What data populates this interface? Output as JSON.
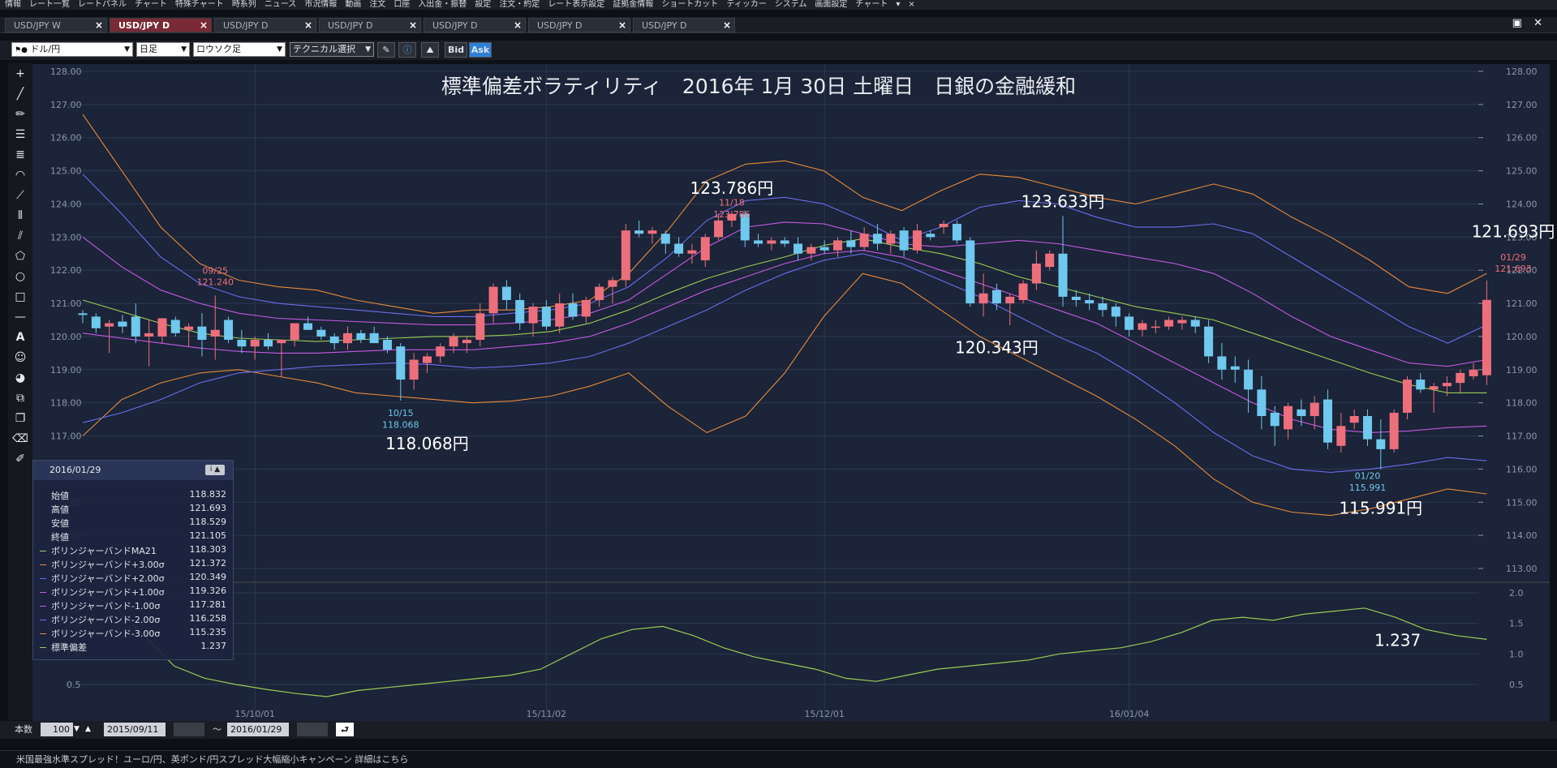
{
  "menu": {
    "items": [
      "情報",
      "レート一覧",
      "レートパネル",
      "チャート",
      "特殊チャート",
      "時系列",
      "ニュース",
      "市況情報",
      "動画",
      "注文",
      "口座",
      "入出金・振替",
      "設定",
      "注文・約定",
      "レート表示設定",
      "証拠金情報",
      "ショートカット",
      "ティッカー",
      "システム",
      "画面設定",
      "チャート"
    ],
    "extra": [
      "▾",
      "×"
    ]
  },
  "tabs": [
    {
      "label": "USD/JPY W",
      "active": false
    },
    {
      "label": "USD/JPY D",
      "active": true
    },
    {
      "label": "USD/JPY D",
      "active": false
    },
    {
      "label": "USD/JPY D",
      "active": false
    },
    {
      "label": "USD/JPY D",
      "active": false
    },
    {
      "label": "USD/JPY D",
      "active": false
    },
    {
      "label": "USD/JPY D",
      "active": false
    }
  ],
  "toolbar": {
    "pair": "ドル/円",
    "period": "日足",
    "chart_style": "ロウソク足",
    "technical": "テクニカル選択",
    "bid": "Bid",
    "ask": "Ask",
    "close_icon": "×"
  },
  "info_panel": {
    "date": "2016/01/29",
    "icon_label": "i ▲",
    "rows": [
      {
        "label": "始値",
        "value": "118.832",
        "color": ""
      },
      {
        "label": "高値",
        "value": "121.693",
        "color": ""
      },
      {
        "label": "安値",
        "value": "118.529",
        "color": ""
      },
      {
        "label": "終値",
        "value": "121.105",
        "color": ""
      },
      {
        "label": "ボリンジャーバンドMA21",
        "value": "118.303",
        "color": "#9acd55"
      },
      {
        "label": "ボリンジャーバンド+3.00σ",
        "value": "121.372",
        "color": "#e88a3a"
      },
      {
        "label": "ボリンジャーバンド+2.00σ",
        "value": "120.349",
        "color": "#6c6cf0"
      },
      {
        "label": "ボリンジャーバンド+1.00σ",
        "value": "119.326",
        "color": "#c659e6"
      },
      {
        "label": "ボリンジャーバンド-1.00σ",
        "value": "117.281",
        "color": "#c659e6"
      },
      {
        "label": "ボリンジャーバンド-2.00σ",
        "value": "116.258",
        "color": "#6c6cf0"
      },
      {
        "label": "ボリンジャーバンド-3.00σ",
        "value": "115.235",
        "color": "#e88a3a"
      },
      {
        "label": "標準偏差",
        "value": "1.237",
        "color": "#9acd55"
      }
    ]
  },
  "bottom": {
    "count_label": "本数",
    "count_value": "100",
    "from_date": "2015/09/11",
    "tilde": "～",
    "to_date": "2016/01/29",
    "reset_icon": "⮐"
  },
  "status_text": "米国最強水準スプレッド！ユーロ/円、英ポンド/円スプレッド大幅縮小キャンペーン 詳細はこちら",
  "colors": {
    "bg": "#1b2438",
    "up": "#ee6f7c",
    "down": "#6fc8ee",
    "ma": "#9acd55",
    "sd1": "#c659e6",
    "sd2": "#6c6cf0",
    "sd3": "#e88a3a"
  },
  "chart_data": {
    "type": "candlestick",
    "title": "標準偏差ボラティリティ　2016年 1月 30日 土曜日　日銀の金融緩和",
    "ylim": [
      113,
      128
    ],
    "yticks": [
      "128.00",
      "127.00",
      "126.00",
      "125.00",
      "124.00",
      "123.00",
      "122.00",
      "121.00",
      "120.00",
      "119.00",
      "118.00",
      "117.00",
      "116.00",
      "115.00",
      "114.00",
      "113.00"
    ],
    "x_labels": [
      {
        "label": "15/10/01",
        "index": 13
      },
      {
        "label": "15/11/02",
        "index": 35
      },
      {
        "label": "15/12/01",
        "index": 56
      },
      {
        "label": "16/01/04",
        "index": 79
      }
    ],
    "candles": [
      [
        120.7,
        120.8,
        120.4,
        120.65
      ],
      [
        120.6,
        120.7,
        120.1,
        120.25
      ],
      [
        120.3,
        120.5,
        119.5,
        120.4
      ],
      [
        120.45,
        120.65,
        120.1,
        120.3
      ],
      [
        120.6,
        121.0,
        119.8,
        120.0
      ],
      [
        120.0,
        120.5,
        119.1,
        120.1
      ],
      [
        120.0,
        120.4,
        119.8,
        120.55
      ],
      [
        120.5,
        120.6,
        120.0,
        120.1
      ],
      [
        120.2,
        120.4,
        119.7,
        120.3
      ],
      [
        120.3,
        120.7,
        119.4,
        119.9
      ],
      [
        120.0,
        121.24,
        119.3,
        120.2
      ],
      [
        120.5,
        120.6,
        119.8,
        119.9
      ],
      [
        119.9,
        120.2,
        119.5,
        119.7
      ],
      [
        119.7,
        120.0,
        119.3,
        119.9
      ],
      [
        119.9,
        120.1,
        119.6,
        119.7
      ],
      [
        119.8,
        119.9,
        118.8,
        119.9
      ],
      [
        119.9,
        120.4,
        119.7,
        120.4
      ],
      [
        120.4,
        120.6,
        120.2,
        120.2
      ],
      [
        120.2,
        120.3,
        119.9,
        120.0
      ],
      [
        120.0,
        120.1,
        119.6,
        119.8
      ],
      [
        119.8,
        120.3,
        119.6,
        120.1
      ],
      [
        120.1,
        120.2,
        119.8,
        119.9
      ],
      [
        120.1,
        120.3,
        119.8,
        119.8
      ],
      [
        119.9,
        120.0,
        119.5,
        119.6
      ],
      [
        119.7,
        119.8,
        118.068,
        118.7
      ],
      [
        118.7,
        119.5,
        118.4,
        119.3
      ],
      [
        119.2,
        119.5,
        118.9,
        119.4
      ],
      [
        119.4,
        119.8,
        119.2,
        119.7
      ],
      [
        119.7,
        120.1,
        119.5,
        120.0
      ],
      [
        119.8,
        120.0,
        119.5,
        119.9
      ],
      [
        119.9,
        121.0,
        119.7,
        120.7
      ],
      [
        120.7,
        121.6,
        120.4,
        121.5
      ],
      [
        121.5,
        121.7,
        120.8,
        121.1
      ],
      [
        121.1,
        121.3,
        120.2,
        120.4
      ],
      [
        120.4,
        121.0,
        120.0,
        120.9
      ],
      [
        120.9,
        121.1,
        120.2,
        120.3
      ],
      [
        120.3,
        121.3,
        120.1,
        121.0
      ],
      [
        121.0,
        121.3,
        120.5,
        120.6
      ],
      [
        120.6,
        121.2,
        120.4,
        121.1
      ],
      [
        121.1,
        121.6,
        120.9,
        121.5
      ],
      [
        121.5,
        121.8,
        121.0,
        121.7
      ],
      [
        121.7,
        123.4,
        121.5,
        123.2
      ],
      [
        123.2,
        123.5,
        123.0,
        123.1
      ],
      [
        123.1,
        123.3,
        122.8,
        123.2
      ],
      [
        123.1,
        123.2,
        122.5,
        122.8
      ],
      [
        122.8,
        123.0,
        122.4,
        122.5
      ],
      [
        122.5,
        122.8,
        122.2,
        122.6
      ],
      [
        122.3,
        123.1,
        122.1,
        123.0
      ],
      [
        123.0,
        123.7,
        122.9,
        123.5
      ],
      [
        123.5,
        123.786,
        123.3,
        123.7
      ],
      [
        123.7,
        123.8,
        122.7,
        122.9
      ],
      [
        122.9,
        123.1,
        122.7,
        122.8
      ],
      [
        122.8,
        123.0,
        122.6,
        122.9
      ],
      [
        122.9,
        123.0,
        122.7,
        122.8
      ],
      [
        122.8,
        123.0,
        122.3,
        122.5
      ],
      [
        122.5,
        122.8,
        122.3,
        122.7
      ],
      [
        122.7,
        122.9,
        122.5,
        122.6
      ],
      [
        122.6,
        123.0,
        122.4,
        122.9
      ],
      [
        122.9,
        123.2,
        122.5,
        122.7
      ],
      [
        122.7,
        123.3,
        122.6,
        123.1
      ],
      [
        123.1,
        123.4,
        122.6,
        122.8
      ],
      [
        122.8,
        123.2,
        122.5,
        123.1
      ],
      [
        123.2,
        123.3,
        122.4,
        122.6
      ],
      [
        122.6,
        123.4,
        122.5,
        123.2
      ],
      [
        123.1,
        123.2,
        122.9,
        123.0
      ],
      [
        123.3,
        123.5,
        123.1,
        123.4
      ],
      [
        123.4,
        123.5,
        122.8,
        122.9
      ],
      [
        122.9,
        123.0,
        120.9,
        121.0
      ],
      [
        121.0,
        121.9,
        120.6,
        121.3
      ],
      [
        121.4,
        121.6,
        120.8,
        121.0
      ],
      [
        121.0,
        121.3,
        120.343,
        121.2
      ],
      [
        121.1,
        121.7,
        121.0,
        121.6
      ],
      [
        121.6,
        122.6,
        121.4,
        122.2
      ],
      [
        122.1,
        122.6,
        122.0,
        122.5
      ],
      [
        122.5,
        123.633,
        120.9,
        121.2
      ],
      [
        121.2,
        121.4,
        120.9,
        121.1
      ],
      [
        121.1,
        121.3,
        120.8,
        121.0
      ],
      [
        121.0,
        121.2,
        120.6,
        120.8
      ],
      [
        120.9,
        121.0,
        120.3,
        120.6
      ],
      [
        120.6,
        120.7,
        120.0,
        120.2
      ],
      [
        120.2,
        120.5,
        120.0,
        120.4
      ],
      [
        120.3,
        120.5,
        120.1,
        120.3
      ],
      [
        120.3,
        120.6,
        120.2,
        120.5
      ],
      [
        120.4,
        120.6,
        120.2,
        120.5
      ],
      [
        120.5,
        120.6,
        120.1,
        120.3
      ],
      [
        120.3,
        120.5,
        119.2,
        119.4
      ],
      [
        119.4,
        119.8,
        118.7,
        119.0
      ],
      [
        119.1,
        119.4,
        118.6,
        119.0
      ],
      [
        119.0,
        119.3,
        117.7,
        118.4
      ],
      [
        118.4,
        118.8,
        117.2,
        117.6
      ],
      [
        117.7,
        117.9,
        116.7,
        117.3
      ],
      [
        117.2,
        118.0,
        116.9,
        117.9
      ],
      [
        117.8,
        118.1,
        117.3,
        117.6
      ],
      [
        117.6,
        118.2,
        117.2,
        118.0
      ],
      [
        118.1,
        118.4,
        116.6,
        116.8
      ],
      [
        116.7,
        117.7,
        116.5,
        117.3
      ],
      [
        117.4,
        117.8,
        117.2,
        117.6
      ],
      [
        117.6,
        117.8,
        116.7,
        116.9
      ],
      [
        116.9,
        117.5,
        115.991,
        116.6
      ],
      [
        116.6,
        117.8,
        116.5,
        117.7
      ],
      [
        117.7,
        118.8,
        117.5,
        118.7
      ],
      [
        118.7,
        118.9,
        118.3,
        118.4
      ],
      [
        118.4,
        118.6,
        117.7,
        118.5
      ],
      [
        118.5,
        118.8,
        118.2,
        118.6
      ],
      [
        118.6,
        119.0,
        118.3,
        118.9
      ],
      [
        118.8,
        119.2,
        118.7,
        119.0
      ],
      [
        118.832,
        121.693,
        118.529,
        121.105
      ]
    ],
    "bands": {
      "ma": [
        121.1,
        120.75,
        120.4,
        120.1,
        119.95,
        119.9,
        119.85,
        119.9,
        119.95,
        120.0,
        120.0,
        120.05,
        120.15,
        120.4,
        120.8,
        121.3,
        121.75,
        122.1,
        122.4,
        122.75,
        122.95,
        122.7,
        122.5,
        122.2,
        121.8,
        121.5,
        121.2,
        120.9,
        120.7,
        120.5,
        120.1,
        119.7,
        119.3,
        118.9,
        118.55,
        118.3,
        118.3
      ],
      "sd1": [
        120.1,
        119.95,
        119.8,
        119.65,
        119.55,
        119.5,
        119.5,
        119.55,
        119.6,
        119.6,
        119.6,
        119.7,
        119.8,
        120.0,
        120.4,
        120.9,
        121.4,
        121.8,
        122.2,
        122.5,
        122.6,
        122.4,
        122.0,
        121.6,
        121.2,
        120.8,
        120.4,
        119.8,
        119.2,
        118.6,
        118.0,
        117.5,
        117.2,
        117.1,
        117.15,
        117.25,
        117.3
      ],
      "sd2": [
        117.4,
        117.7,
        118.1,
        118.6,
        118.9,
        119.0,
        119.1,
        119.15,
        119.2,
        119.15,
        119.05,
        119.1,
        119.2,
        119.4,
        119.8,
        120.3,
        120.8,
        121.4,
        121.9,
        122.3,
        122.5,
        122.2,
        121.7,
        121.2,
        120.6,
        120.0,
        119.5,
        118.8,
        118.0,
        117.1,
        116.4,
        116.0,
        115.9,
        116.0,
        116.15,
        116.35,
        116.25
      ],
      "sd3": [
        126.7,
        125.0,
        123.3,
        122.2,
        121.7,
        121.5,
        121.4,
        121.1,
        120.9,
        120.7,
        120.8,
        120.8,
        120.9,
        121.1,
        121.9,
        123.2,
        124.7,
        125.2,
        125.3,
        125.0,
        124.2,
        123.8,
        124.4,
        124.9,
        124.8,
        124.5,
        124.2,
        124.0,
        124.3,
        124.6,
        124.3,
        123.6,
        123.0,
        122.3,
        121.5,
        121.3,
        121.9
      ],
      "sd3l": [
        117.0,
        118.1,
        118.6,
        118.9,
        119.0,
        118.8,
        118.6,
        118.3,
        118.2,
        118.1,
        118.0,
        118.05,
        118.2,
        118.5,
        118.9,
        117.9,
        117.1,
        117.6,
        118.9,
        120.6,
        121.9,
        121.6,
        120.8,
        120.0,
        119.4,
        118.8,
        118.2,
        117.5,
        116.7,
        115.7,
        115.0,
        114.7,
        114.6,
        114.8,
        115.1,
        115.4,
        115.25
      ],
      "sd2u": [
        124.9,
        123.7,
        122.4,
        121.6,
        121.2,
        121.0,
        120.9,
        120.8,
        120.7,
        120.6,
        120.6,
        120.7,
        120.8,
        121.0,
        121.5,
        122.4,
        123.5,
        124.1,
        124.2,
        124.0,
        123.5,
        122.9,
        123.3,
        123.9,
        124.1,
        124.0,
        123.6,
        123.3,
        123.3,
        123.4,
        123.1,
        122.4,
        121.7,
        121.0,
        120.3,
        119.8,
        120.35
      ],
      "sd1u": [
        123.0,
        122.1,
        121.4,
        121.0,
        120.7,
        120.55,
        120.5,
        120.45,
        120.4,
        120.35,
        120.35,
        120.4,
        120.5,
        120.7,
        121.1,
        121.9,
        122.7,
        123.3,
        123.45,
        123.4,
        123.1,
        122.8,
        122.7,
        122.8,
        122.9,
        122.8,
        122.6,
        122.4,
        122.2,
        121.9,
        121.3,
        120.6,
        120.0,
        119.6,
        119.2,
        119.1,
        119.3
      ]
    },
    "lower_panel": {
      "ylim": [
        0.3,
        2.0
      ],
      "yticks": [
        "2.0",
        "1.5",
        "1.0",
        "0.5"
      ],
      "values": [
        2.0,
        1.8,
        1.3,
        0.8,
        0.6,
        0.5,
        0.42,
        0.35,
        0.3,
        0.4,
        0.45,
        0.5,
        0.55,
        0.6,
        0.65,
        0.75,
        1.0,
        1.25,
        1.4,
        1.45,
        1.3,
        1.1,
        0.95,
        0.85,
        0.75,
        0.6,
        0.55,
        0.65,
        0.75,
        0.8,
        0.85,
        0.9,
        1.0,
        1.05,
        1.1,
        1.2,
        1.35,
        1.55,
        1.6,
        1.55,
        1.65,
        1.7,
        1.75,
        1.6,
        1.4,
        1.3,
        1.237
      ],
      "value_label": "1.237"
    },
    "annotations": [
      {
        "text": "123.786円",
        "index": 49,
        "price": 124.3,
        "size": "big"
      },
      {
        "text": "11/18",
        "index": 49,
        "price": 123.95,
        "size": "small",
        "color": "#ee6f7c"
      },
      {
        "text": "123.786",
        "index": 49,
        "price": 123.6,
        "size": "small",
        "color": "#ee6f7c"
      },
      {
        "text": "123.633円",
        "index": 74,
        "price": 123.9,
        "size": "big"
      },
      {
        "text": "121.693円",
        "index": 108,
        "price": 123.0,
        "size": "big"
      },
      {
        "text": "01/29",
        "index": 108,
        "price": 122.3,
        "size": "small",
        "color": "#ee6f7c"
      },
      {
        "text": "121.693",
        "index": 108,
        "price": 121.95,
        "size": "small",
        "color": "#ee6f7c"
      },
      {
        "text": "09/25",
        "index": 10,
        "price": 121.9,
        "size": "small",
        "color": "#ee6f7c"
      },
      {
        "text": "121.240",
        "index": 10,
        "price": 121.55,
        "size": "small",
        "color": "#ee6f7c"
      },
      {
        "text": "120.343円",
        "index": 69,
        "price": 119.5,
        "size": "big"
      },
      {
        "text": "10/15",
        "index": 24,
        "price": 117.6,
        "size": "small",
        "color": "#6fc8ee"
      },
      {
        "text": "118.068",
        "index": 24,
        "price": 117.25,
        "size": "small",
        "color": "#6fc8ee"
      },
      {
        "text": "118.068円",
        "index": 26,
        "price": 116.6,
        "size": "big"
      },
      {
        "text": "01/20",
        "index": 97,
        "price": 115.7,
        "size": "small",
        "color": "#6fc8ee"
      },
      {
        "text": "115.991",
        "index": 97,
        "price": 115.35,
        "size": "small",
        "color": "#6fc8ee"
      },
      {
        "text": "115.991円",
        "index": 98,
        "price": 114.65,
        "size": "big"
      }
    ]
  }
}
